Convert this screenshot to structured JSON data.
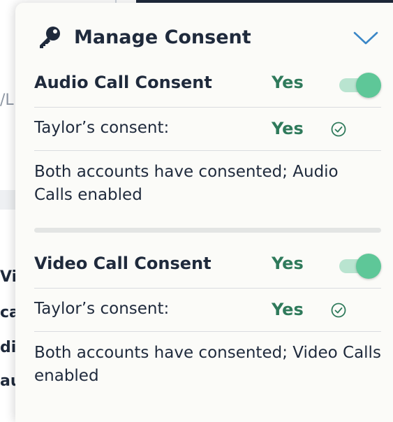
{
  "background": {
    "fragments": [
      "/L",
      "Vi",
      "ca",
      "di",
      "au"
    ]
  },
  "panel": {
    "title": "Manage Consent",
    "icons": {
      "header": "key-icon",
      "collapse": "chevron-down-icon",
      "confirmed": "check-circle-icon"
    },
    "colors": {
      "yes_text": "#2f7a5b",
      "toggle_on": "#5ec798",
      "toggle_track": "#b9e4d0"
    },
    "sections": [
      {
        "title": "Audio Call Consent",
        "value": "Yes",
        "toggle_on": true,
        "partner_label": "Taylor’s consent:",
        "partner_value": "Yes",
        "status": "Both accounts have consented; Audio Calls enabled"
      },
      {
        "title": "Video Call Consent",
        "value": "Yes",
        "toggle_on": true,
        "partner_label": "Taylor’s consent:",
        "partner_value": "Yes",
        "status": "Both accounts have consented; Video Calls enabled"
      }
    ]
  }
}
